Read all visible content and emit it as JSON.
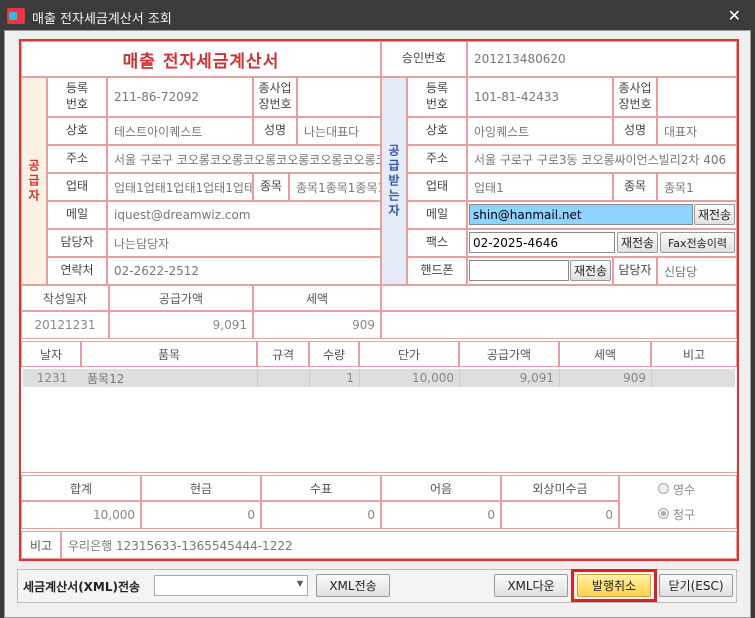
{
  "window": {
    "title": "매출 전자세금계산서 조회",
    "close": "✕"
  },
  "invoice": {
    "heading": "매출 전자세금계산서",
    "approval_label": "승인번호",
    "approval_value": "201213480620",
    "supplier": {
      "section_label": "공급자",
      "reg_no_label": "등록\n번호",
      "reg_no": "211-86-72092",
      "sub_biz_label": "종사업\n장번호",
      "sub_biz": "",
      "company_label": "상호",
      "company": "테스트아이퀘스트",
      "name_label": "성명",
      "name": "나는대표다",
      "address_label": "주소",
      "address": "서울 구로구 코오롱코오롱코오롱코오롱코오롱코오롱코오롱코",
      "biz_type_label": "업태",
      "biz_type": "업태1업태1업태1업태1업태1",
      "biz_item_label": "종목",
      "biz_item": "종목1종목1종목1",
      "email_label": "메일",
      "email": "iquest@dreamwiz.com",
      "manager_label": "담당자",
      "manager": "나는담당자",
      "contact_label": "연락처",
      "contact": "02-2622-2512"
    },
    "receiver": {
      "section_label": "공급받는자",
      "reg_no_label": "등록\n번호",
      "reg_no": "101-81-42433",
      "sub_biz_label": "종사업\n장번호",
      "sub_biz": "",
      "company_label": "상호",
      "company": "아잉퀘스트",
      "name_label": "성명",
      "name": "대표자",
      "address_label": "주소",
      "address": "서울 구로구 구로3동  코오롱싸이언스빌리2차 406",
      "biz_type_label": "업태",
      "biz_type": "업태1",
      "biz_item_label": "종목",
      "biz_item": "종목1",
      "email_label": "메일",
      "email": "shin@hanmail.net",
      "resend_label": "재전송",
      "fax_label": "팩스",
      "fax": "02-2025-4646",
      "fax_history_label": "Fax전송이력",
      "mobile_label": "핸드폰",
      "mobile": "",
      "manager_label": "담당자",
      "manager": "신담당"
    },
    "summary": {
      "date_label": "작성일자",
      "date": "20121231",
      "supply_label": "공급가액",
      "supply": "9,091",
      "tax_label": "세액",
      "tax": "909"
    },
    "items": {
      "headers": [
        "날자",
        "품목",
        "규격",
        "수량",
        "단가",
        "공급가액",
        "세액",
        "비고"
      ],
      "rows": [
        {
          "date": "1231",
          "item": "품목12",
          "spec": "",
          "qty": "1",
          "price": "10,000",
          "supply": "9,091",
          "tax": "909",
          "note": ""
        }
      ]
    },
    "totals": {
      "headers": [
        "합계",
        "현금",
        "수표",
        "어음",
        "외상미수금"
      ],
      "values": [
        "10,000",
        "0",
        "0",
        "0",
        "0"
      ],
      "receipt_label": "영수",
      "claim_label": "청구"
    },
    "note_label": "비고",
    "note": "우리은행 12315633-1365545444-1222"
  },
  "footer": {
    "xml_send_label": "세금계산서(XML)전송",
    "xml_send_select": "",
    "xml_send_button": "XML전송",
    "xml_download": "XML다운",
    "cancel_issue": "발행취소",
    "close": "닫기(ESC)"
  },
  "colors": {
    "accent": "#dd3333",
    "highlight_input": "#8fd3ff",
    "cancel_button": "#ffd966"
  }
}
